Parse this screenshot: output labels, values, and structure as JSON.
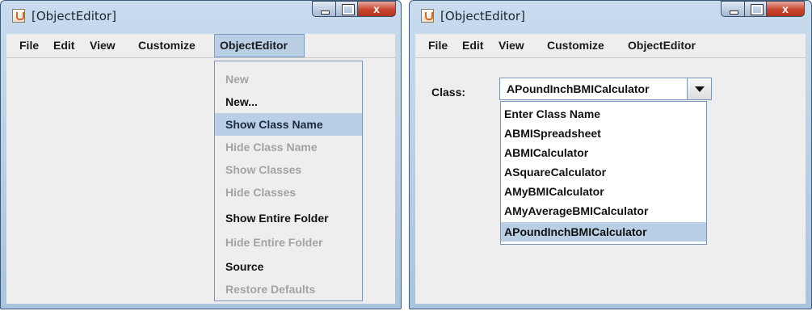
{
  "window1": {
    "title": "[ObjectEditor]",
    "menus": [
      "File",
      "Edit",
      "View",
      "Customize",
      "ObjectEditor"
    ],
    "open_menu": "ObjectEditor",
    "dropdown": [
      {
        "label": "New",
        "enabled": false
      },
      {
        "label": "New...",
        "enabled": true
      },
      {
        "label": "Show Class Name",
        "enabled": true,
        "selected": true
      },
      {
        "label": "Hide Class Name",
        "enabled": false
      },
      {
        "label": "Show Classes",
        "enabled": false
      },
      {
        "label": "Hide Classes",
        "enabled": false
      },
      {
        "label": "Show Entire Folder",
        "enabled": true
      },
      {
        "label": "Hide Entire Folder",
        "enabled": false
      },
      {
        "label": "Source",
        "enabled": true
      },
      {
        "label": "Restore Defaults",
        "enabled": false
      }
    ]
  },
  "window2": {
    "title": "[ObjectEditor]",
    "menus": [
      "File",
      "Edit",
      "View",
      "Customize",
      "ObjectEditor"
    ],
    "class_label": "Class:",
    "combo_value": "APoundInchBMICalculator",
    "options": [
      {
        "label": "Enter Class Name"
      },
      {
        "label": "ABMISpreadsheet"
      },
      {
        "label": "ABMICalculator"
      },
      {
        "label": "ASquareCalculator"
      },
      {
        "label": "AMyBMICalculator"
      },
      {
        "label": "AMyAverageBMICalculator"
      },
      {
        "label": "APoundInchBMICalculator",
        "selected": true
      }
    ]
  },
  "controls": {
    "close_glyph": "x"
  }
}
